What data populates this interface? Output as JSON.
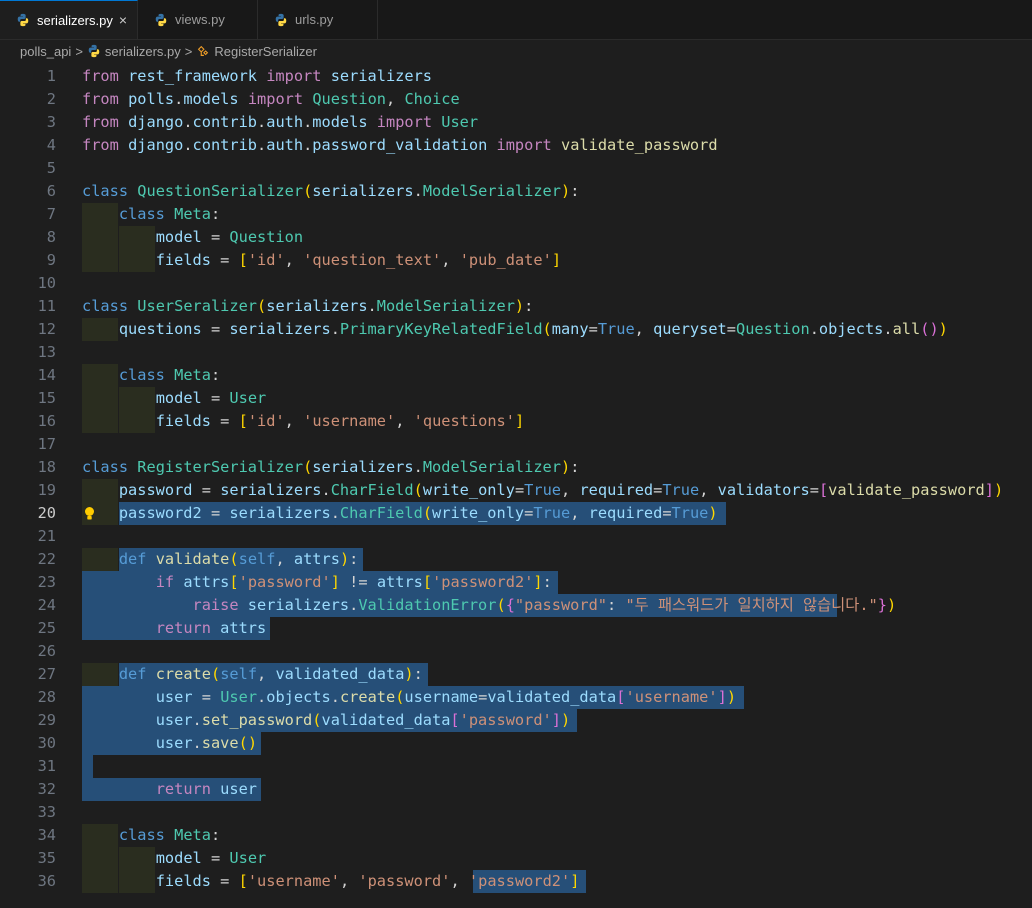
{
  "tabs": [
    {
      "name": "serializers.py",
      "active": true,
      "icon": "python-icon"
    },
    {
      "name": "views.py",
      "active": false,
      "icon": "python-icon"
    },
    {
      "name": "urls.py",
      "active": false,
      "icon": "python-icon"
    }
  ],
  "close_glyph": "×",
  "breadcrumb": {
    "folder": "polls_api",
    "file": "serializers.py",
    "symbol": "RegisterSerializer",
    "separator": ">"
  },
  "current_line": 20,
  "line_numbers": [
    "1",
    "2",
    "3",
    "4",
    "5",
    "6",
    "7",
    "8",
    "9",
    "10",
    "11",
    "12",
    "13",
    "14",
    "15",
    "16",
    "17",
    "18",
    "19",
    "20",
    "21",
    "22",
    "23",
    "24",
    "25",
    "26",
    "27",
    "28",
    "29",
    "30",
    "31",
    "32",
    "33",
    "34",
    "35",
    "36"
  ],
  "code": [
    "from rest_framework import serializers",
    "from polls.models import Question, Choice",
    "from django.contrib.auth.models import User",
    "from django.contrib.auth.password_validation import validate_password",
    "",
    "class QuestionSerializer(serializers.ModelSerializer):",
    "    class Meta:",
    "        model = Question",
    "        fields = ['id', 'question_text', 'pub_date']",
    "",
    "class UserSeralizer(serializers.ModelSerializer):",
    "    questions = serializers.PrimaryKeyRelatedField(many=True, queryset=Question.objects.all())",
    "",
    "    class Meta:",
    "        model = User",
    "        fields = ['id', 'username', 'questions']",
    "",
    "class RegisterSerializer(serializers.ModelSerializer):",
    "    password = serializers.CharField(write_only=True, required=True, validators=[validate_password])",
    "    password2 = serializers.CharField(write_only=True, required=True)",
    "",
    "    def validate(self, attrs):",
    "        if attrs['password'] != attrs['password2']:",
    "            raise serializers.ValidationError({\"password\": \"두 패스워드가 일치하지 않습니다.\"})",
    "        return attrs",
    "",
    "    def create(self, validated_data):",
    "        user = User.objects.create(username=validated_data['username'])",
    "        user.set_password(validated_data['password'])",
    "        user.save()",
    "",
    "        return user",
    "",
    "    class Meta:",
    "        model = User",
    "        fields = ['username', 'password', 'password2']"
  ],
  "colors": {
    "background": "#1e1e1e",
    "keyword": "#c586c0",
    "storage": "#569cd6",
    "class": "#4ec9b0",
    "function": "#dcdcaa",
    "variable": "#9cdcfe",
    "string": "#ce9178",
    "selection": "#264f78",
    "indent": "#2a2d1f",
    "line_number": "#6e7681",
    "accent": "#0078d4"
  }
}
